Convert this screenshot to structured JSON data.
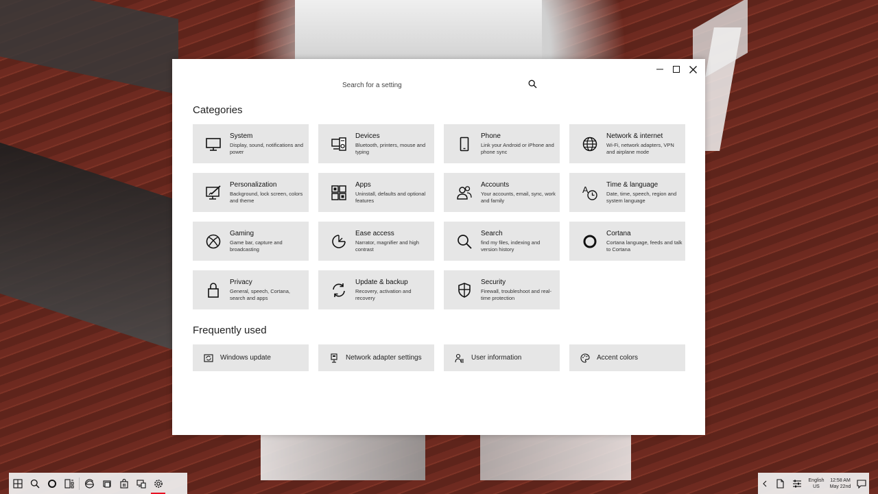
{
  "window": {
    "search_placeholder": "Search for a setting",
    "controls": [
      "minimize",
      "maximize",
      "close"
    ]
  },
  "categories": {
    "title": "Categories",
    "items": [
      {
        "title": "System",
        "desc": "Display, sound, notifications and power",
        "icon": "monitor-icon"
      },
      {
        "title": "Devices",
        "desc": "Bluetooth, printers, mouse and typing",
        "icon": "devices-icon"
      },
      {
        "title": "Phone",
        "desc": "Link your Android or iPhone and phone sync",
        "icon": "phone-icon"
      },
      {
        "title": "Network & internet",
        "desc": "Wi-Fi, network adapters, VPN and airplane mode",
        "icon": "globe-icon"
      },
      {
        "title": "Personalization",
        "desc": "Background, lock screen, colors and theme",
        "icon": "paint-icon"
      },
      {
        "title": "Apps",
        "desc": "Uninstall, defaults and optional features",
        "icon": "apps-icon"
      },
      {
        "title": "Accounts",
        "desc": "Your accounts, email, sync, work and family",
        "icon": "accounts-icon"
      },
      {
        "title": "Time & language",
        "desc": "Date, time, speech, region and system language",
        "icon": "time-language-icon"
      },
      {
        "title": "Gaming",
        "desc": "Game bar, capture and broadcasting",
        "icon": "xbox-icon"
      },
      {
        "title": "Ease access",
        "desc": "Narrator, magnifier and high contrast",
        "icon": "ease-access-icon"
      },
      {
        "title": "Search",
        "desc": "find my files, indexing and version history",
        "icon": "search-icon"
      },
      {
        "title": "Cortana",
        "desc": "Cortana language, feeds and talk to Cortana",
        "icon": "cortana-icon"
      },
      {
        "title": "Privacy",
        "desc": "General, speech, Cortana, search and apps",
        "icon": "lock-icon"
      },
      {
        "title": "Update & backup",
        "desc": "Recovery, activation and recovery",
        "icon": "sync-icon"
      },
      {
        "title": "Security",
        "desc": "Firewall, troubleshoot and real-time protection",
        "icon": "shield-icon"
      }
    ]
  },
  "frequently_used": {
    "title": "Frequently used",
    "items": [
      {
        "label": "Windows update",
        "icon": "update-icon"
      },
      {
        "label": "Network adapter settings",
        "icon": "ethernet-icon"
      },
      {
        "label": "User information",
        "icon": "user-info-icon"
      },
      {
        "label": "Accent colors",
        "icon": "palette-icon"
      }
    ]
  },
  "taskbar": {
    "apps": [
      "start-icon",
      "search-icon",
      "cortana-icon",
      "task-view-icon",
      "edge-icon",
      "explorer-icon",
      "store-icon",
      "device-manager-icon",
      "settings-icon"
    ],
    "active_app": "settings-icon",
    "tray": {
      "language_top": "English",
      "language_bottom": "US",
      "time": "12:58 AM",
      "date": "May 22nd"
    },
    "accent": "#e81123"
  }
}
